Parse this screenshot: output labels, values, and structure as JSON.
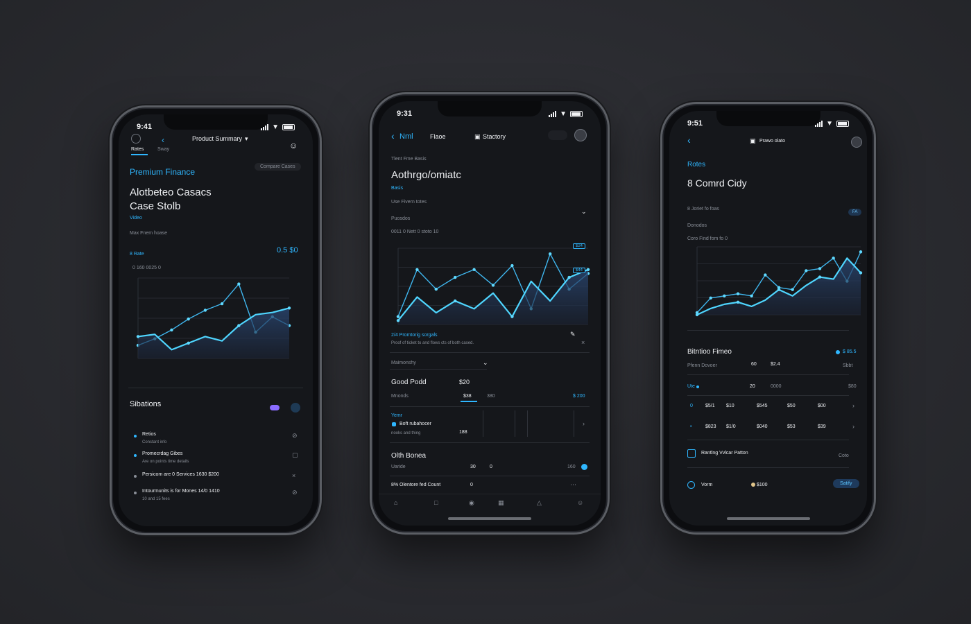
{
  "phone1": {
    "time": "9:41",
    "tab_active": "Rates",
    "tab_second": "Sway",
    "nav_title": "Product Summary",
    "heading": "Premium Finance",
    "badge": "Compare Cases",
    "title_line1": "Alotbeteo Casacs",
    "title_line2": "Case Stolb",
    "subtitle": "Video",
    "section_label": "Max Fnem hoase",
    "chart_label": "8 Rate",
    "chart_value": "0.5 $0",
    "chart_sublabel": "0 160 0025 0",
    "chart_data": {
      "type": "line",
      "series": [
        {
          "values": [
            6,
            9,
            13,
            18,
            22,
            25,
            34,
            12,
            19,
            15
          ]
        },
        {
          "values": [
            10,
            11,
            4,
            7,
            10,
            8,
            15,
            20,
            21,
            23
          ]
        }
      ]
    },
    "list_title": "Sibations",
    "list_items": [
      {
        "label": "Retios",
        "sub": "Constant info"
      },
      {
        "label": "Promecrdag Gibes",
        "sub": "Are on points time details"
      },
      {
        "label": "Persicom are 0 Services 1630 $200",
        "sub": ""
      },
      {
        "label": "Intourmunits is for Mones 14/0 1410",
        "sub": "10 and 15 fees"
      }
    ]
  },
  "phone2": {
    "time": "9:31",
    "back_label": "Nml",
    "nav_tab": "Flaoe",
    "nav_title": "Stactory",
    "eyebrow": "Tlent Fme Basis",
    "title": "Aothrgo/omiatc",
    "subtitle": "Basis",
    "dropdown_label": "Use Fivern totes",
    "field_label": "Puosdos",
    "chart_caption": "0011 0 Nett 0 stoto 10",
    "chart_data": {
      "type": "line",
      "series": [
        {
          "values": [
            2,
            14,
            9,
            12,
            14,
            10,
            15,
            4,
            18,
            9,
            13
          ]
        },
        {
          "values": [
            1,
            7,
            3,
            6,
            4,
            8,
            2,
            11,
            6,
            12,
            14
          ]
        }
      ]
    },
    "chart_tag1": "$24",
    "chart_tag2": "$44",
    "note_title": "2/4 Promtorig sorgals",
    "note_sub": "Proof of ticket to and flows cts of both cased.",
    "select_label": "Maimonshy",
    "good_label": "Good Podd",
    "good_value": "$20",
    "row1_label": "Mnonds",
    "row1_v1": "$38",
    "row1_v2": "380",
    "row1_v3": "$ 200",
    "sub_section": "Yemr",
    "sub_item": "Boft rubahocer",
    "sub_item_sub": "nooks and thing",
    "sub_value": "188",
    "oth_title": "Olth Bonea",
    "oth_label": "Uaride",
    "oth_v1": "30",
    "oth_v2": "0",
    "oth_v3": "160",
    "footer_label": "8% Olentore fed Count",
    "footer_value": "0"
  },
  "phone3": {
    "time": "9:51",
    "nav_title": "Prawo olato",
    "section_label": "Rotes",
    "title": "8 Comrd Cidy",
    "sub1": "8 Joriet fo foas",
    "badge": "FA",
    "field_label": "Donodos",
    "chart_caption": "Coro Find fom fo 0",
    "chart_data": {
      "type": "line",
      "series": [
        {
          "values": [
            1,
            8,
            9,
            10,
            9,
            19,
            13,
            12,
            21,
            22,
            27,
            16,
            30
          ]
        },
        {
          "values": [
            0,
            3,
            5,
            6,
            4,
            7,
            12,
            9,
            14,
            18,
            17,
            27,
            20
          ]
        }
      ]
    },
    "table_title": "Bitntioo Fimeo",
    "table_value": "$ 85.5",
    "th1": "Pfenn Dovoer",
    "th2": "60",
    "th3": "$2.4",
    "th4": "Sbbt",
    "r1_label": "Ute",
    "r1_v1": "20",
    "r1_v2": "0000",
    "r1_v3": "$80",
    "grid_rows": [
      [
        "0",
        "$5/1",
        "$10",
        "$545",
        "$50",
        "$00"
      ],
      [
        "•",
        "$823",
        "$1/0",
        "$040",
        "$53",
        "$39"
      ]
    ],
    "link_label": "Rantlng Vvlcar Patton",
    "link_aux": "Coto",
    "footer_label": "Vorm",
    "footer_value": "$100",
    "footer_button": "Satify"
  }
}
